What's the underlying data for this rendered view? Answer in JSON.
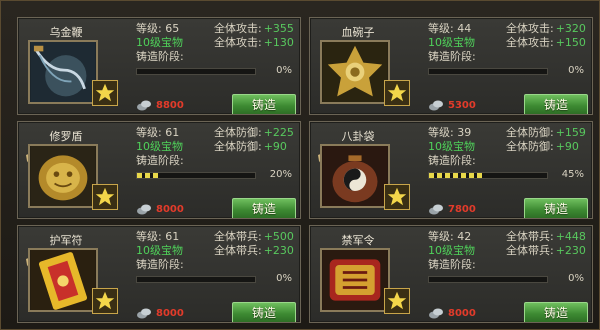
{
  "labels": {
    "level": "等级:",
    "stage": "铸造阶段:",
    "forge_button": "铸造"
  },
  "items": [
    {
      "name": "乌金鞭",
      "level": "65",
      "quality": "10级宝物",
      "stat1_label": "全体攻击:",
      "stat1_value": "+355",
      "stat2_label": "全体攻击:",
      "stat2_value": "+130",
      "progress": 0,
      "progress_text": "0%",
      "cost": "8800"
    },
    {
      "name": "血碗子",
      "level": "44",
      "quality": "10级宝物",
      "stat1_label": "全体攻击:",
      "stat1_value": "+320",
      "stat2_label": "全体攻击:",
      "stat2_value": "+150",
      "progress": 0,
      "progress_text": "0%",
      "cost": "5300"
    },
    {
      "name": "修罗盾",
      "level": "61",
      "quality": "10级宝物",
      "stat1_label": "全体防御:",
      "stat1_value": "+225",
      "stat2_label": "全体防御:",
      "stat2_value": "+90",
      "progress": 20,
      "progress_text": "20%",
      "cost": "8000"
    },
    {
      "name": "八卦袋",
      "level": "39",
      "quality": "10级宝物",
      "stat1_label": "全体防御:",
      "stat1_value": "+159",
      "stat2_label": "全体防御:",
      "stat2_value": "+90",
      "progress": 45,
      "progress_text": "45%",
      "cost": "7800"
    },
    {
      "name": "护军符",
      "level": "61",
      "quality": "10级宝物",
      "stat1_label": "全体带兵:",
      "stat1_value": "+500",
      "stat2_label": "全体带兵:",
      "stat2_value": "+230",
      "progress": 0,
      "progress_text": "0%",
      "cost": "8000"
    },
    {
      "name": "禁军令",
      "level": "42",
      "quality": "10级宝物",
      "stat1_label": "全体带兵:",
      "stat1_value": "+448",
      "stat2_label": "全体带兵:",
      "stat2_value": "+230",
      "progress": 0,
      "progress_text": "0%",
      "cost": "8000"
    }
  ],
  "icons": {
    "coin": "silver-coin-icon",
    "star": "star-badge-icon",
    "shield": "shield-icon"
  },
  "colors": {
    "cost": "#e33b2a",
    "quality": "#4fd15a",
    "stat": "#58c85e",
    "button": "#3d8a32"
  }
}
